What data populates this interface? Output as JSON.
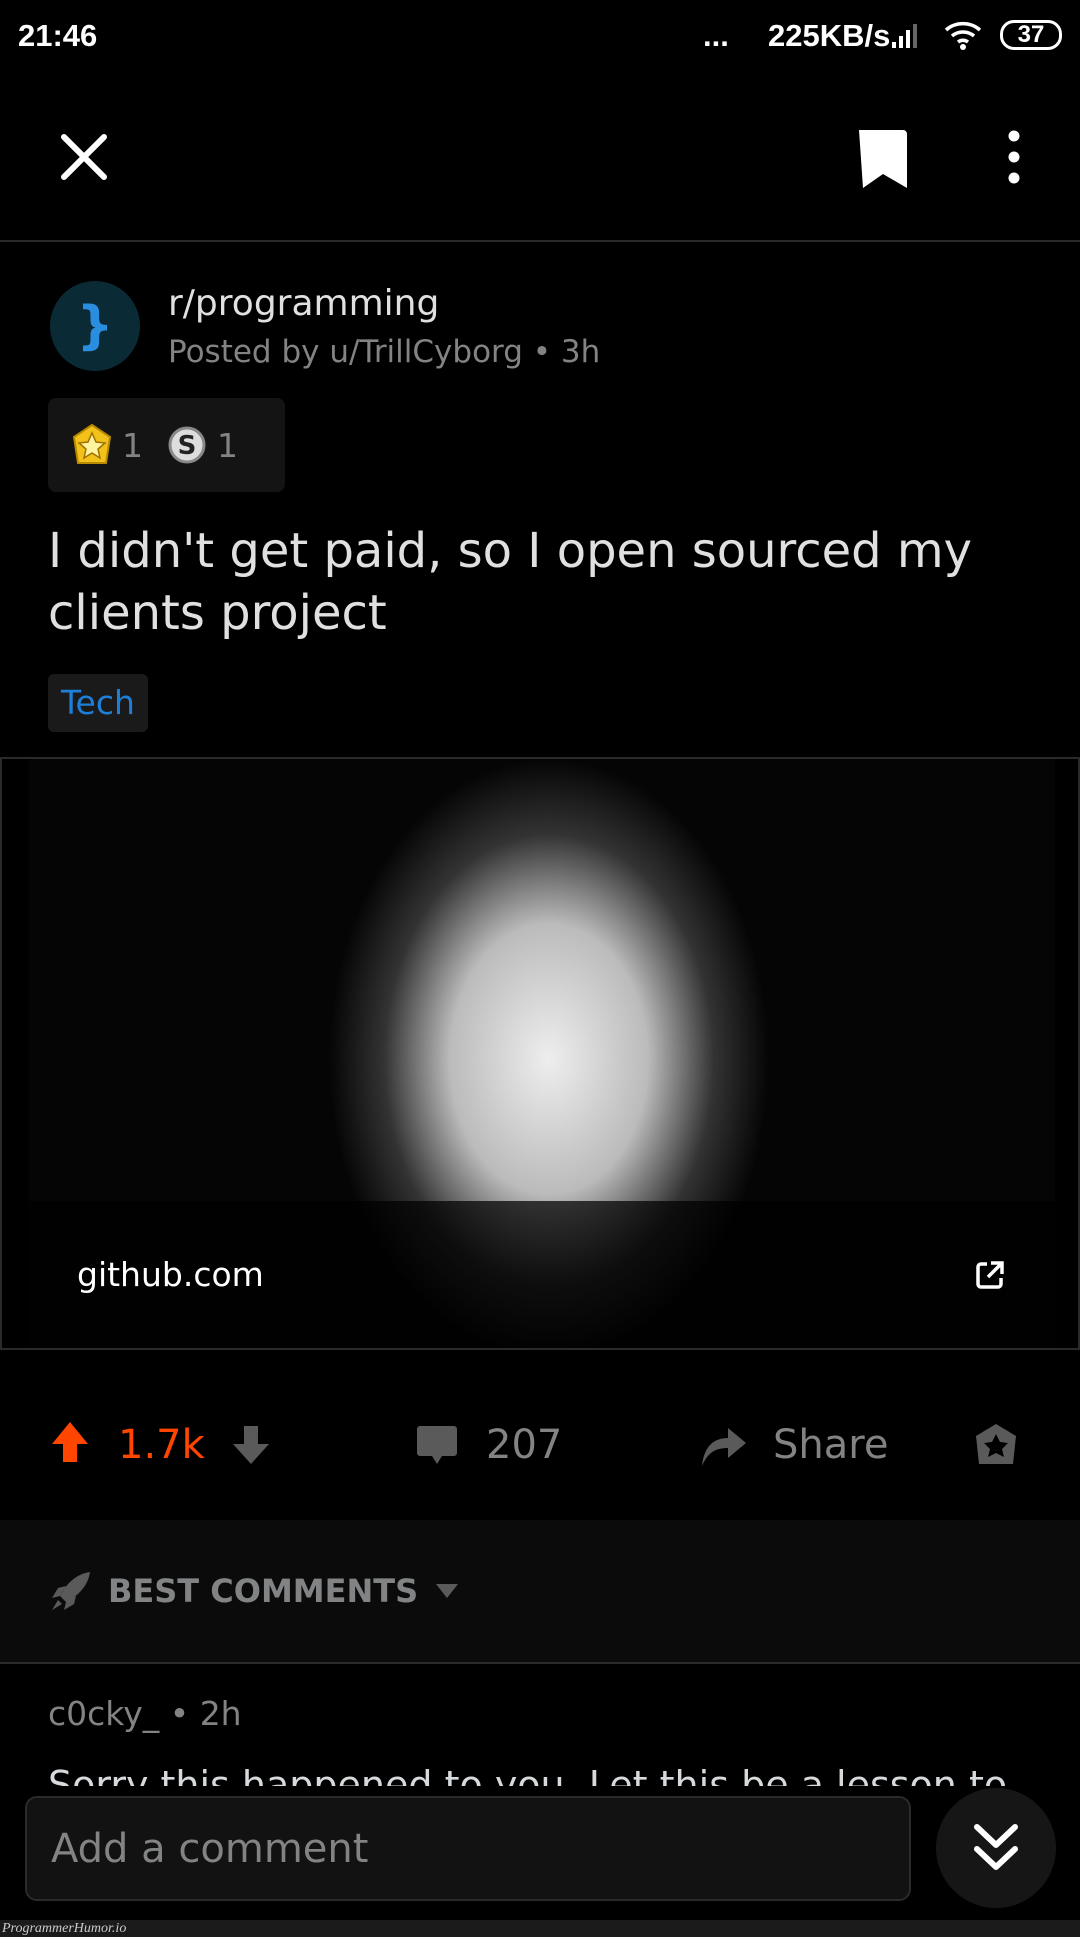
{
  "status_bar": {
    "time": "21:46",
    "dots": "...",
    "speed": "225KB/s",
    "battery": "37"
  },
  "toolbar": {
    "close_icon": "close-icon",
    "save_icon": "bookmark-icon",
    "more_icon": "more-vertical-icon"
  },
  "post": {
    "subreddit": "r/programming",
    "posted_by": "Posted by u/TrillCyborg • 3h",
    "awards": [
      {
        "icon": "gold-award-icon",
        "count": "1"
      },
      {
        "icon": "silver-award-icon",
        "count": "1"
      }
    ],
    "title": "I didn't get paid, so I open sourced my clients project",
    "flair": "Tech",
    "link_domain": "github.com",
    "votes": "1.7k",
    "comments": "207",
    "share_label": "Share"
  },
  "colors": {
    "upvote": "#ff4500",
    "flair": "#1e7fd8",
    "background": "#000000"
  },
  "comments_section": {
    "sort_label": "BEST COMMENTS",
    "first_comment": {
      "user_meta": "c0cky_ • 2h",
      "body": "Sorry this happened to you. Let this be a lesson to"
    }
  },
  "composer": {
    "placeholder": "Add a comment"
  },
  "watermark": "ProgrammerHumor.io"
}
